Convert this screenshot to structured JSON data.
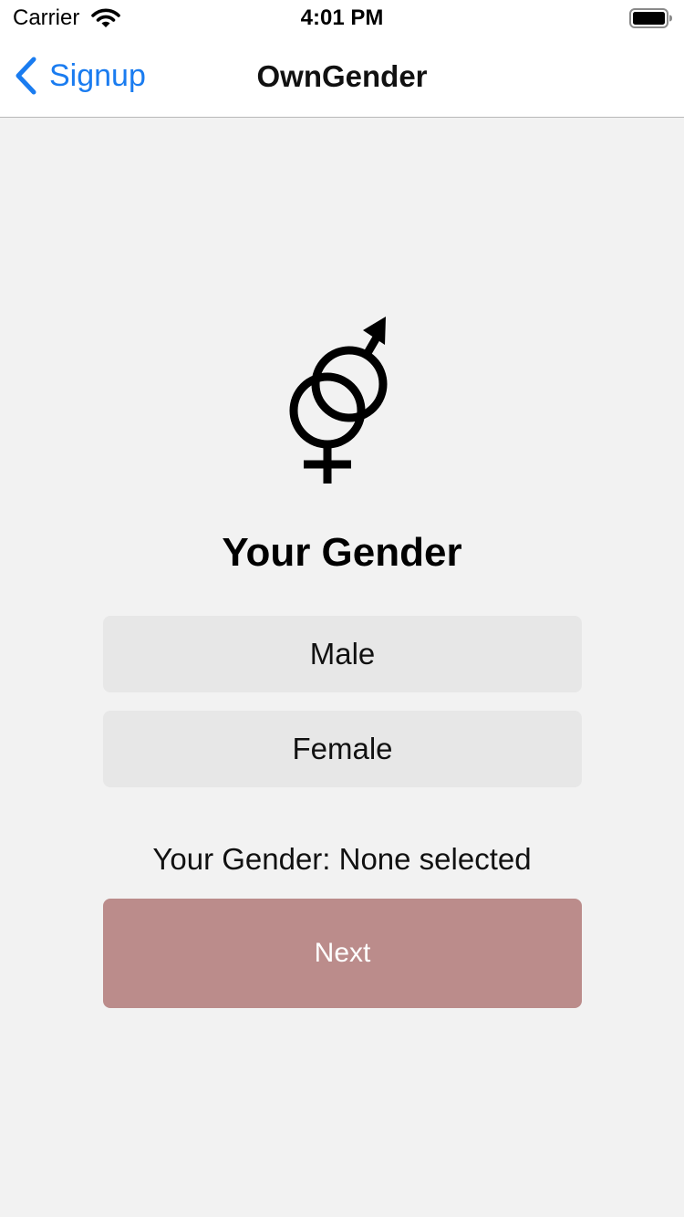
{
  "status_bar": {
    "carrier": "Carrier",
    "time": "4:01 PM"
  },
  "nav": {
    "back_label": "Signup",
    "title": "OwnGender"
  },
  "main": {
    "icon": "gender-symbol-icon",
    "heading": "Your Gender",
    "options": [
      {
        "label": "Male"
      },
      {
        "label": "Female"
      }
    ],
    "selection_text": "Your Gender: None selected",
    "next_label": "Next"
  },
  "colors": {
    "accent": "#1a7cf0",
    "background": "#f2f2f2",
    "option_background": "#e7e7e7",
    "next_button": "#bb8c8b"
  }
}
